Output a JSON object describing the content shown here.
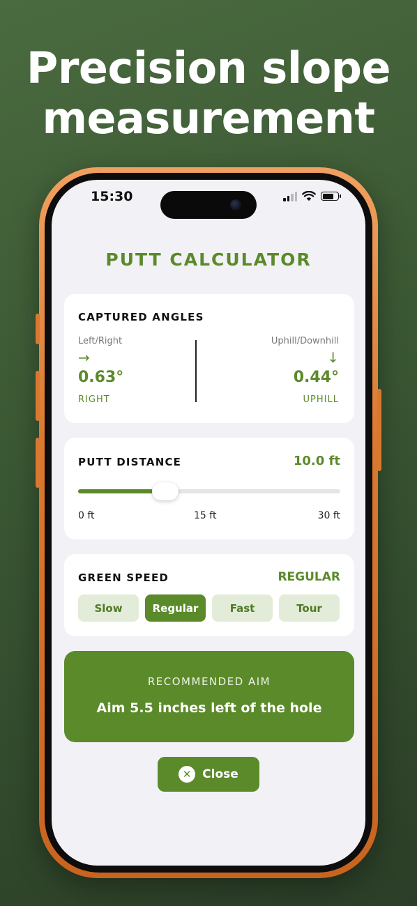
{
  "headline": {
    "line1": "Precision slope",
    "line2": "measurement"
  },
  "status_bar": {
    "time": "15:30",
    "icons": [
      "signal-icon",
      "wifi-icon",
      "battery-icon"
    ]
  },
  "screen_title": "PUTT CALCULATOR",
  "captured_angles": {
    "heading": "CAPTURED ANGLES",
    "left": {
      "label": "Left/Right",
      "arrow_icon": "arrow-right-icon",
      "value": "0.63°",
      "direction": "RIGHT"
    },
    "right": {
      "label": "Uphill/Downhill",
      "arrow_icon": "arrow-down-icon",
      "value": "0.44°",
      "direction": "UPHILL"
    }
  },
  "putt_distance": {
    "heading": "PUTT DISTANCE",
    "value": "10.0 ft",
    "slider_fraction": 0.333,
    "ticks": [
      "0 ft",
      "15 ft",
      "30 ft"
    ]
  },
  "green_speed": {
    "heading": "GREEN SPEED",
    "selected": "REGULAR",
    "options": [
      "Slow",
      "Regular",
      "Fast",
      "Tour"
    ],
    "active_index": 1
  },
  "recommended_aim": {
    "heading": "RECOMMENDED AIM",
    "text": "Aim 5.5 inches left of the hole"
  },
  "close_button": {
    "label": "Close",
    "icon": "close-icon"
  },
  "colors": {
    "accent": "#5b8a2a",
    "accent_light": "#e3ecd8",
    "background": "#3a5733",
    "frame": "#d9782e"
  }
}
